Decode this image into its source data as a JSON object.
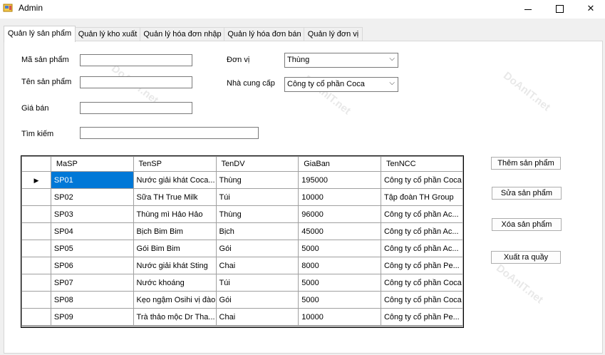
{
  "window": {
    "title": "Admin",
    "min_icon": "minimize-icon",
    "max_icon": "maximize-icon",
    "close_icon": "close-icon"
  },
  "tabs": [
    "Quản lý sản phẩm",
    "Quản lý kho xuất",
    "Quản lý hóa đơn nhập",
    "Quản lý hóa đơn bán",
    "Quản lý đơn vị"
  ],
  "form": {
    "ma_label": "Mã sản phẩm",
    "ten_label": "Tên sản phẩm",
    "gia_label": "Giá bán",
    "tim_label": "Tìm kiếm",
    "donvi_label": "Đơn vị",
    "donvi_value": "Thùng",
    "ncc_label": "Nhà cung cấp",
    "ncc_value": "Công ty cổ phần Coca"
  },
  "buttons": {
    "add": "Thêm sản phẩm",
    "edit": "Sửa sản phẩm",
    "delete": "Xóa sản phẩm",
    "export": "Xuất ra quầy"
  },
  "grid": {
    "columns": [
      "MaSP",
      "TenSP",
      "TenDV",
      "GiaBan",
      "TenNCC"
    ],
    "rows": [
      [
        "SP01",
        "Nước giải khát Coca...",
        "Thùng",
        "195000",
        "Công ty cổ phần Coca"
      ],
      [
        "SP02",
        "Sữa TH True Milk",
        "Túi",
        "10000",
        "Tập đoàn TH Group"
      ],
      [
        "SP03",
        "Thùng mì Hảo Hảo",
        "Thùng",
        "96000",
        "Công ty cổ phần Ac..."
      ],
      [
        "SP04",
        "Bịch Bim Bim",
        "Bịch",
        "45000",
        "Công ty cổ phần Ac..."
      ],
      [
        "SP05",
        "Gói Bim Bim",
        "Gói",
        "5000",
        "Công ty cổ phần Ac..."
      ],
      [
        "SP06",
        "Nước giải khát Sting",
        "Chai",
        "8000",
        "Công ty cổ phần Pe..."
      ],
      [
        "SP07",
        "Nước khoáng",
        "Túi",
        "5000",
        "Công ty cổ phần Coca"
      ],
      [
        "SP08",
        "Kẹo ngậm Osihi vị đào",
        "Gói",
        "5000",
        "Công ty cổ phần Coca"
      ],
      [
        "SP09",
        "Trà thảo mộc Dr Tha...",
        "Chai",
        "10000",
        "Công ty cổ phần Pe..."
      ]
    ]
  },
  "watermark": "DoAnIT.net",
  "colors": {
    "selection": "#0078d7"
  }
}
